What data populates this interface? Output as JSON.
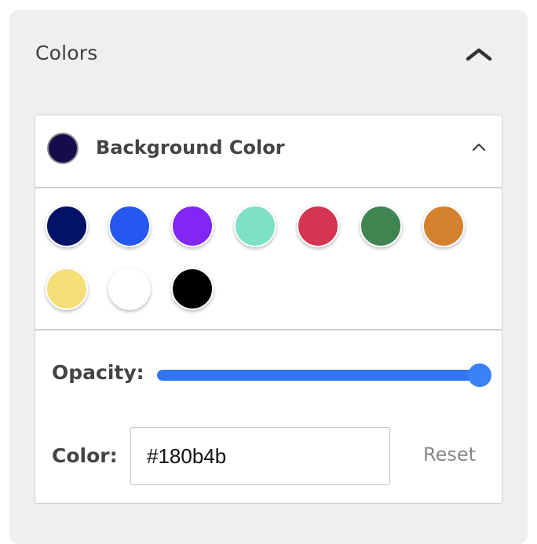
{
  "panel": {
    "title": "Colors"
  },
  "background_color": {
    "title": "Background Color",
    "current_color": "#180b4b",
    "swatches": [
      "#031266",
      "#2458ee",
      "#8126f3",
      "#7ee1c6",
      "#d43553",
      "#3f8451",
      "#d3812f",
      "#f4df78",
      "#ffffff",
      "#000000"
    ],
    "opacity_label": "Opacity:",
    "opacity": 1.0,
    "color_label": "Color:",
    "color_value": "#180b4b",
    "reset_label": "Reset"
  }
}
